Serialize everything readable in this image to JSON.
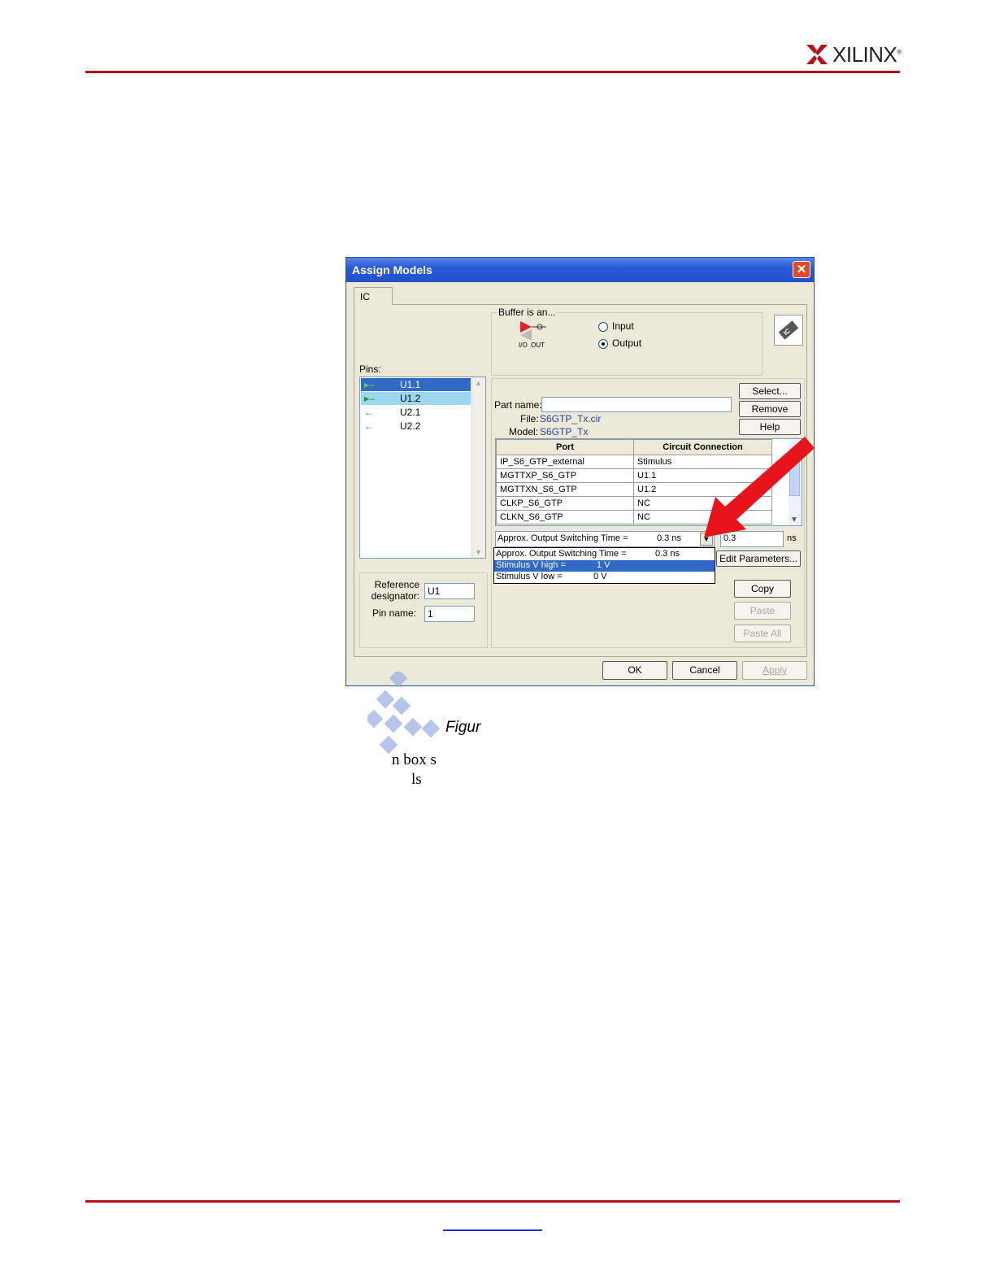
{
  "header": {
    "logo_text": "XILINX",
    "logo_mark": "®"
  },
  "dialog": {
    "title": "Assign Models",
    "close_glyph": "✕",
    "tab_ic": "IC",
    "pins_label": "Pins:",
    "pins": [
      {
        "label": "U1.1",
        "state": "selected"
      },
      {
        "label": "U1.2",
        "state": "highlighted"
      },
      {
        "label": "U2.1",
        "state": "normal"
      },
      {
        "label": "U2.2",
        "state": "normal"
      }
    ],
    "buffer_group_label": "Buffer is an...",
    "buffer_icon_io": "I/O",
    "buffer_icon_out": "OUT",
    "radio_input": "Input",
    "radio_output": "Output",
    "radio_selected": "Output",
    "part_name_label": "Part name:",
    "part_name_value": "",
    "file_label": "File:",
    "file_value": "S6GTP_Tx.cir",
    "model_label": "Model:",
    "model_value": "S6GTP_Tx",
    "select_button": "Select...",
    "remove_button": "Remove",
    "help_button": "Help",
    "ports_header": {
      "port": "Port",
      "connection": "Circuit Connection"
    },
    "ports": [
      {
        "port": "IP_S6_GTP_external",
        "connection": "Stimulus"
      },
      {
        "port": "MGTTXP_S6_GTP",
        "connection": "U1.1"
      },
      {
        "port": "MGTTXN_S6_GTP",
        "connection": "U1.2"
      },
      {
        "port": "CLKP_S6_GTP",
        "connection": "NC"
      },
      {
        "port": "CLKN_S6_GTP",
        "connection": "NC"
      }
    ],
    "param_combo_label": "Approx. Output Switching Time  =",
    "param_combo_value": "0.3 ns",
    "param_value_input": "0.3",
    "param_unit": "ns",
    "dropdown_options": [
      {
        "label": "Approx. Output Switching Time  =",
        "value": "0.3 ns"
      },
      {
        "label": "Stimulus V high  =",
        "value": "1  V"
      },
      {
        "label": "Stimulus V low  =",
        "value": "0  V"
      }
    ],
    "dropdown_selected_index": 1,
    "edit_parameters_button": "Edit Parameters...",
    "copy_button": "Copy",
    "paste_button": "Paste",
    "paste_all_button": "Paste All",
    "ref_designator_label": "Reference designator:",
    "ref_designator_value": "U1",
    "pin_name_label": "Pin name:",
    "pin_name_value": "1",
    "ok_button": "OK",
    "cancel_button": "Cancel",
    "apply_button": "Apply"
  },
  "caption": {
    "figure": "Figur",
    "frag1": "n box s",
    "frag2": "ls"
  },
  "colors": {
    "rule": "#b5121b",
    "titlebar": "#2a5bd7",
    "arrow": "#e8141c"
  }
}
